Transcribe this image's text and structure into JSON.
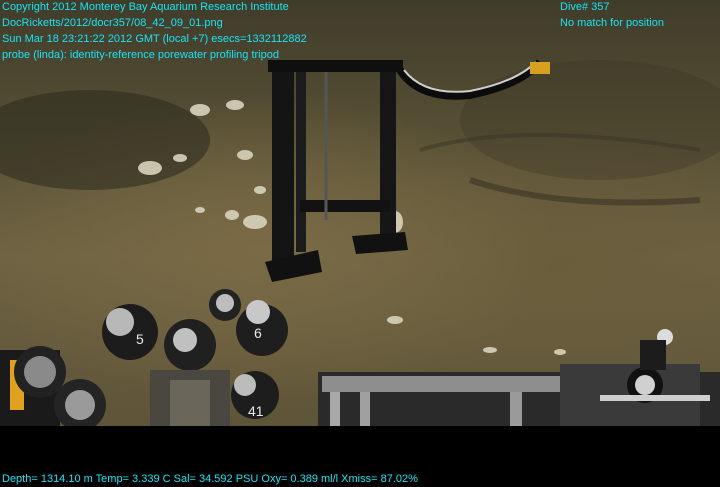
{
  "overlay": {
    "top_left": [
      "Copyright 2012 Monterey Bay Aquarium Research Institute",
      "DocRicketts/2012/docr357/08_42_09_01.png",
      "Sun Mar 18 23:21:22 2012 GMT (local +7)  esecs=1332112882",
      "probe (linda): identity-reference porewater profiling tripod"
    ],
    "top_right": [
      "Dive# 357",
      "No match for position"
    ],
    "bottom": "Depth= 1314.10 m  Temp= 3.339 C  Sal= 34.592 PSU  Oxy= 0.389 ml/l  Xmiss= 87.02%"
  },
  "scene": {
    "description_tags": [
      "seafloor-sediment",
      "clam-shells",
      "profiling-tripod",
      "sample-tubes",
      "rov-tray"
    ],
    "tube_labels": [
      "5",
      "6",
      "41"
    ]
  },
  "colors": {
    "overlay_text": "#19e3f5",
    "sediment": "#6e6243",
    "background": "#000000"
  }
}
